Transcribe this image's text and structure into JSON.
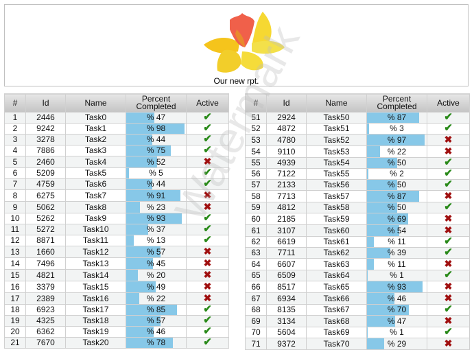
{
  "header": {
    "logo": "daffodil-flower-image",
    "caption": "Our new rpt."
  },
  "columns": [
    "#",
    "Id",
    "Name",
    "Percent Completed",
    "Active"
  ],
  "colors": {
    "bar": "#87c8e8",
    "check": "#2a8a1a",
    "cross": "#a01010"
  },
  "watermark": "Watermark",
  "left_table": [
    {
      "n": "1",
      "id": "2446",
      "name": "Task0",
      "pct": 47,
      "active": true
    },
    {
      "n": "2",
      "id": "9242",
      "name": "Task1",
      "pct": 98,
      "active": true
    },
    {
      "n": "3",
      "id": "3278",
      "name": "Task2",
      "pct": 44,
      "active": true
    },
    {
      "n": "4",
      "id": "7886",
      "name": "Task3",
      "pct": 75,
      "active": true
    },
    {
      "n": "5",
      "id": "2460",
      "name": "Task4",
      "pct": 52,
      "active": false
    },
    {
      "n": "6",
      "id": "5209",
      "name": "Task5",
      "pct": 5,
      "active": true
    },
    {
      "n": "7",
      "id": "4759",
      "name": "Task6",
      "pct": 44,
      "active": true
    },
    {
      "n": "8",
      "id": "6275",
      "name": "Task7",
      "pct": 91,
      "active": false
    },
    {
      "n": "9",
      "id": "5062",
      "name": "Task8",
      "pct": 23,
      "active": false
    },
    {
      "n": "10",
      "id": "5262",
      "name": "Task9",
      "pct": 93,
      "active": true
    },
    {
      "n": "11",
      "id": "5272",
      "name": "Task10",
      "pct": 37,
      "active": true
    },
    {
      "n": "12",
      "id": "8871",
      "name": "Task11",
      "pct": 13,
      "active": true
    },
    {
      "n": "13",
      "id": "1660",
      "name": "Task12",
      "pct": 57,
      "active": false
    },
    {
      "n": "14",
      "id": "7496",
      "name": "Task13",
      "pct": 45,
      "active": false
    },
    {
      "n": "15",
      "id": "4821",
      "name": "Task14",
      "pct": 20,
      "active": false
    },
    {
      "n": "16",
      "id": "3379",
      "name": "Task15",
      "pct": 49,
      "active": false
    },
    {
      "n": "17",
      "id": "2389",
      "name": "Task16",
      "pct": 22,
      "active": false
    },
    {
      "n": "18",
      "id": "6923",
      "name": "Task17",
      "pct": 85,
      "active": true
    },
    {
      "n": "19",
      "id": "4325",
      "name": "Task18",
      "pct": 57,
      "active": true
    },
    {
      "n": "20",
      "id": "6362",
      "name": "Task19",
      "pct": 46,
      "active": true
    },
    {
      "n": "21",
      "id": "7670",
      "name": "Task20",
      "pct": 78,
      "active": true
    }
  ],
  "right_table": [
    {
      "n": "51",
      "id": "2924",
      "name": "Task50",
      "pct": 87,
      "active": true
    },
    {
      "n": "52",
      "id": "4872",
      "name": "Task51",
      "pct": 3,
      "active": true
    },
    {
      "n": "53",
      "id": "4780",
      "name": "Task52",
      "pct": 97,
      "active": false
    },
    {
      "n": "54",
      "id": "9110",
      "name": "Task53",
      "pct": 22,
      "active": false
    },
    {
      "n": "55",
      "id": "4939",
      "name": "Task54",
      "pct": 50,
      "active": true
    },
    {
      "n": "56",
      "id": "7122",
      "name": "Task55",
      "pct": 2,
      "active": true
    },
    {
      "n": "57",
      "id": "2133",
      "name": "Task56",
      "pct": 50,
      "active": true
    },
    {
      "n": "58",
      "id": "7713",
      "name": "Task57",
      "pct": 87,
      "active": false
    },
    {
      "n": "59",
      "id": "4812",
      "name": "Task58",
      "pct": 50,
      "active": true
    },
    {
      "n": "60",
      "id": "2185",
      "name": "Task59",
      "pct": 69,
      "active": false
    },
    {
      "n": "61",
      "id": "3107",
      "name": "Task60",
      "pct": 54,
      "active": false
    },
    {
      "n": "62",
      "id": "6619",
      "name": "Task61",
      "pct": 11,
      "active": true
    },
    {
      "n": "63",
      "id": "7711",
      "name": "Task62",
      "pct": 39,
      "active": true
    },
    {
      "n": "64",
      "id": "6607",
      "name": "Task63",
      "pct": 11,
      "active": false
    },
    {
      "n": "65",
      "id": "6509",
      "name": "Task64",
      "pct": 1,
      "active": true
    },
    {
      "n": "66",
      "id": "8517",
      "name": "Task65",
      "pct": 93,
      "active": false
    },
    {
      "n": "67",
      "id": "6934",
      "name": "Task66",
      "pct": 46,
      "active": false
    },
    {
      "n": "68",
      "id": "8135",
      "name": "Task67",
      "pct": 70,
      "active": true
    },
    {
      "n": "69",
      "id": "3134",
      "name": "Task68",
      "pct": 47,
      "active": false
    },
    {
      "n": "70",
      "id": "5604",
      "name": "Task69",
      "pct": 1,
      "active": true
    },
    {
      "n": "71",
      "id": "9372",
      "name": "Task70",
      "pct": 29,
      "active": false
    }
  ]
}
